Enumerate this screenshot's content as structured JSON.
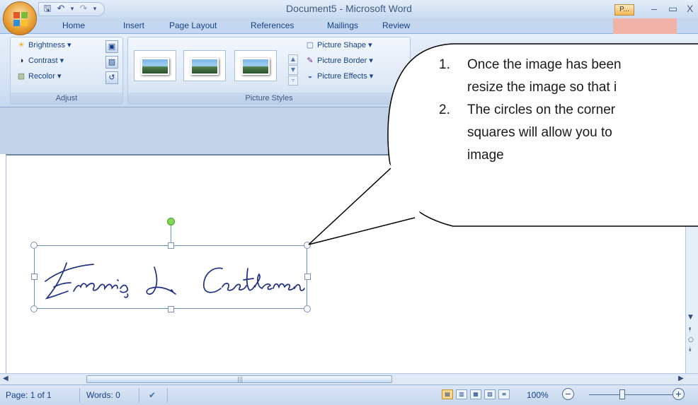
{
  "window": {
    "title": "Document5 - Microsoft Word",
    "help_badge": "P...",
    "minimize": "–",
    "maximize": "▭",
    "close": "X"
  },
  "quick_access": {
    "save_icon": "save-icon",
    "undo_icon": "undo-icon",
    "redo_icon": "redo-icon"
  },
  "tabs": [
    "Home",
    "Insert",
    "Page Layout",
    "References",
    "Mailings",
    "Review"
  ],
  "ribbon": {
    "adjust": {
      "label": "Adjust",
      "brightness": "Brightness",
      "contrast": "Contrast",
      "recolor": "Recolor"
    },
    "picture_styles": {
      "label": "Picture Styles",
      "picture_shape": "Picture Shape",
      "picture_border": "Picture Border",
      "picture_effects": "Picture Effects"
    }
  },
  "callout": {
    "items": [
      {
        "num": "1.",
        "lines": [
          "Once the image has been",
          "resize the image so that i"
        ]
      },
      {
        "num": "2.",
        "lines": [
          "The circles on the corner",
          "squares will allow you to",
          "image"
        ]
      }
    ]
  },
  "status_bar": {
    "page": "Page: 1 of 1",
    "words": "Words: 0",
    "zoom": "100%",
    "zoom_out": "−",
    "zoom_in": "+"
  },
  "colors": {
    "ribbon_blue": "#d7e4f4",
    "tab_text": "#15428b",
    "rotate_handle": "#7ed957",
    "context_tab": "#f1b2a8"
  }
}
